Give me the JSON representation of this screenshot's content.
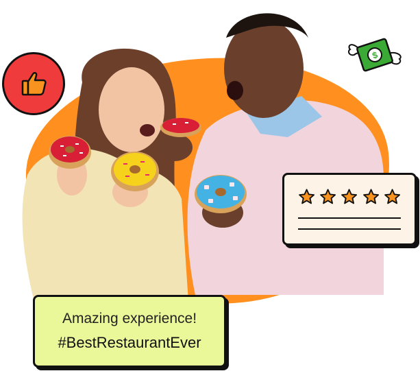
{
  "review": {
    "line1": "Amazing experience!",
    "line2": "#BestRestaurantEver"
  },
  "rating": {
    "stars": 5,
    "max": 5
  },
  "icons": {
    "thumb": "thumbs-up-icon",
    "money": "flying-money-icon",
    "star": "star-icon"
  },
  "colors": {
    "blob": "#ff8f1f",
    "thumb_badge": "#ef3b3b",
    "review_bg": "#ebf89a",
    "rating_bg": "#fdf3e6",
    "star": "#f7931e"
  }
}
